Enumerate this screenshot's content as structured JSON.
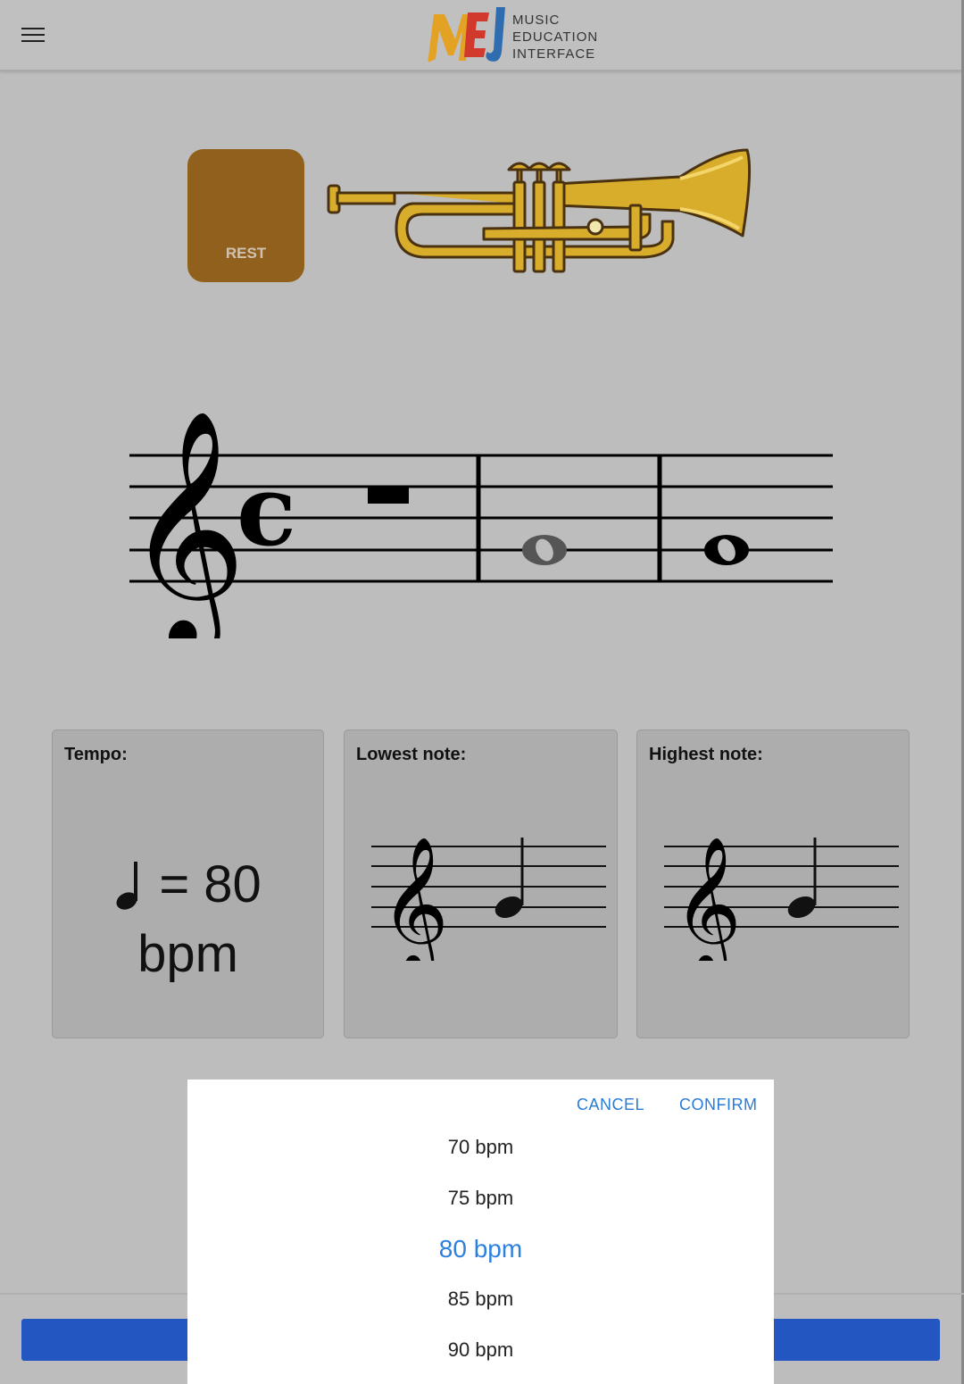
{
  "header": {
    "logo_mark": "MEI",
    "logo_lines": [
      "MUSIC",
      "EDUCATION",
      "INTERFACE"
    ]
  },
  "rest_button": {
    "label": "REST",
    "color": "#91601d"
  },
  "instrument": {
    "icon": "trumpet-icon"
  },
  "cards": {
    "tempo": {
      "title": "Tempo:",
      "value": "= 80",
      "unit": "bpm"
    },
    "lowest": {
      "title": "Lowest note:"
    },
    "highest": {
      "title": "Highest note:"
    }
  },
  "picker": {
    "cancel": "CANCEL",
    "confirm": "CONFIRM",
    "options": [
      "70 bpm",
      "75 bpm",
      "80 bpm",
      "85 bpm",
      "90 bpm"
    ],
    "selected": "80 bpm",
    "accent": "#2d7fe0"
  },
  "colors": {
    "primary_button": "#2356c1",
    "background": "#bdbdbd"
  }
}
